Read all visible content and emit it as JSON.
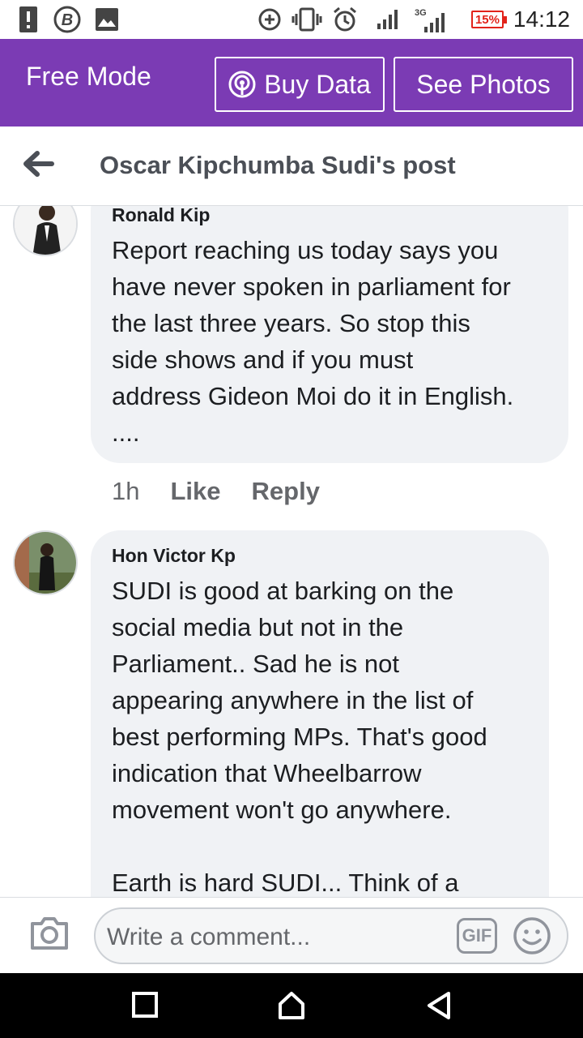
{
  "status_bar": {
    "battery": "15%",
    "time": "14:12",
    "network_label": "3G"
  },
  "free_mode_bar": {
    "label": "Free Mode",
    "buy_data": "Buy Data",
    "see_photos": "See Photos"
  },
  "header": {
    "title": "Oscar Kipchumba Sudi's post"
  },
  "comments": [
    {
      "author": "Ronald Kip",
      "text": "Report reaching us today says you\nhave never spoken in parliament for\nthe last three years. So stop this\nside shows and if you must\naddress Gideon Moi do it in English.\n....",
      "time": "1h",
      "like": "Like",
      "reply": "Reply"
    },
    {
      "author": "Hon Victor Kp",
      "text": "SUDI is good at barking on the\nsocial media but not in the\nParliament.. Sad he is not\nappearing anywhere in the list of\nbest performing MPs. That's good\nindication that Wheelbarrow\nmovement won't go anywhere.\n\nEarth is hard SUDI... Think of a"
    }
  ],
  "compose": {
    "placeholder": "Write a comment...",
    "gif_label": "GIF"
  },
  "colors": {
    "brand_purple": "#7b3bb4",
    "bubble_bg": "#f0f2f5",
    "battery_red": "#e2231a"
  }
}
